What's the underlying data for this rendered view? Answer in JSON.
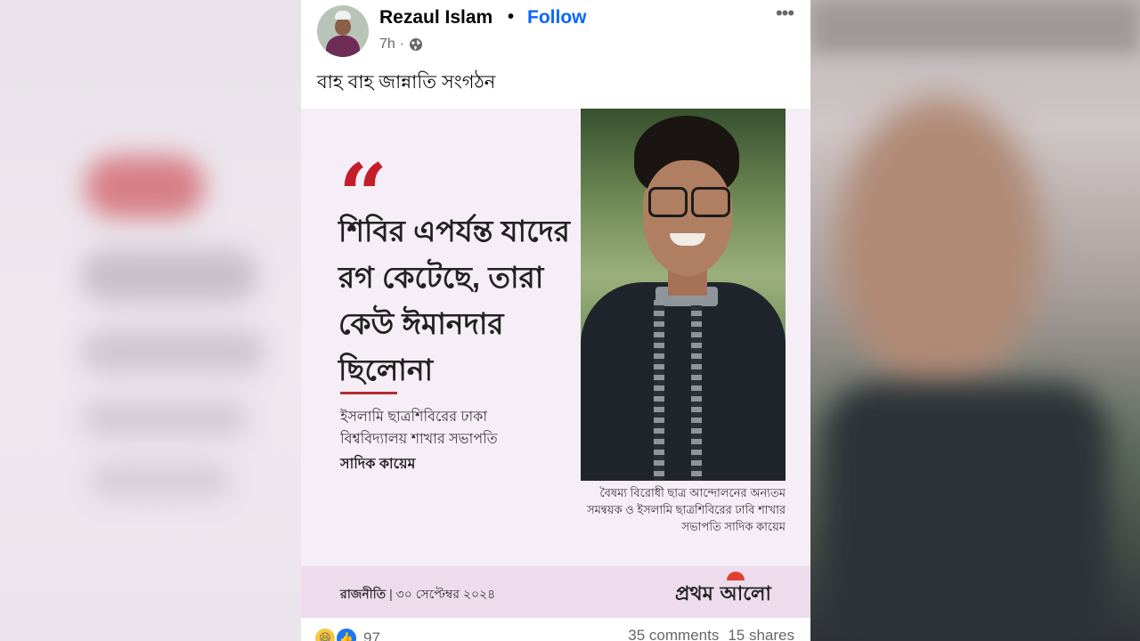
{
  "post": {
    "author": "Rezaul Islam",
    "separator": "•",
    "follow_label": "Follow",
    "time": "7h",
    "meta_dot": "·",
    "visibility_icon": "globe-icon",
    "more_label": "•••",
    "caption": "বাহ বাহ জান্নাতি সংগঠন"
  },
  "shared_image": {
    "quote_mark": "“",
    "quote": "শিবির এপর্যন্ত যাদের রগ কেটেছে, তারা কেউ ঈমানদার ছিলোনা",
    "description": "ইসলামি ছাত্রশিবিরের ঢাকা বিশ্ববিদ্যালয় শাখার সভাপতি",
    "speaker": "সাদিক কায়েম",
    "photo_caption": "বৈষম্য বিরোধী ছাত্র আন্দোলনের অন্যতম সমন্বয়ক ও ইসলামি ছাত্রশিবিরের ঢাবি শাখার সভাপতি সাদিক কায়েম",
    "category": "রাজনীতি",
    "date_sep": "|",
    "date": "৩০ সেপ্টেম্বর ২০২৪",
    "logo": "প্রথম আলো"
  },
  "reactions": {
    "count": "97",
    "comments": "35 comments",
    "shares": "15 shares"
  },
  "colors": {
    "follow_blue": "#0866ff",
    "quote_red": "#c41e2a"
  }
}
